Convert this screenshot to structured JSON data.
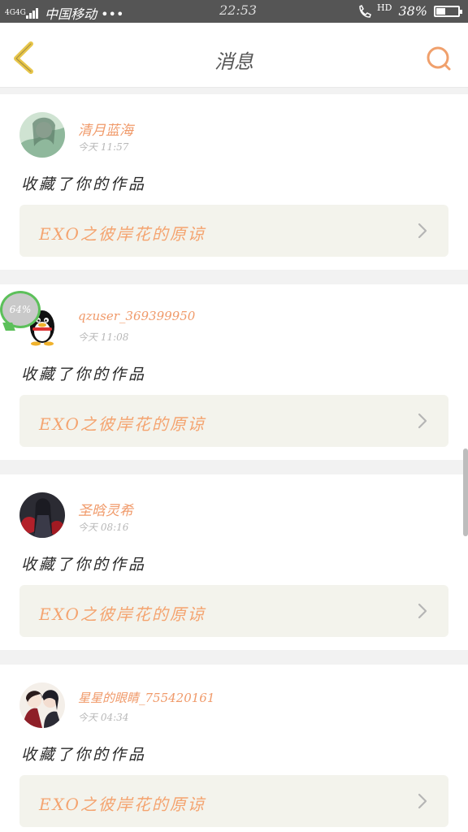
{
  "status_bar": {
    "network": "4G4G",
    "carrier": "中国移动 •••",
    "time": "22:53",
    "call_icon": "hd-call-icon",
    "hd": "HD",
    "battery_percent": "38%",
    "battery_level": 0.38
  },
  "header": {
    "title": "消息",
    "back_icon": "chevron-left-icon",
    "search_icon": "search-icon",
    "accent": "#f0a06c",
    "back_color": "#e8c64a"
  },
  "messages": [
    {
      "username": "清月蓝海",
      "time": "今天 11:57",
      "action": "收藏了你的作品",
      "work_title": "EXO之彼岸花的原谅",
      "avatar": "anime-green-avatar"
    },
    {
      "username": "qzuser_369399950",
      "time": "今天 11:08",
      "action": "收藏了你的作品",
      "work_title": "EXO之彼岸花的原谅",
      "avatar": "qq-penguin-avatar",
      "badge": "64%"
    },
    {
      "username": "圣晗灵希",
      "time": "今天 08:16",
      "action": "收藏了你的作品",
      "work_title": "EXO之彼岸花的原谅",
      "avatar": "dark-red-avatar"
    },
    {
      "username": "星星的眼睛_755420161",
      "time": "今天 04:34",
      "action": "收藏了你的作品",
      "work_title": "EXO之彼岸花的原谅",
      "avatar": "anime-couple-avatar"
    }
  ]
}
